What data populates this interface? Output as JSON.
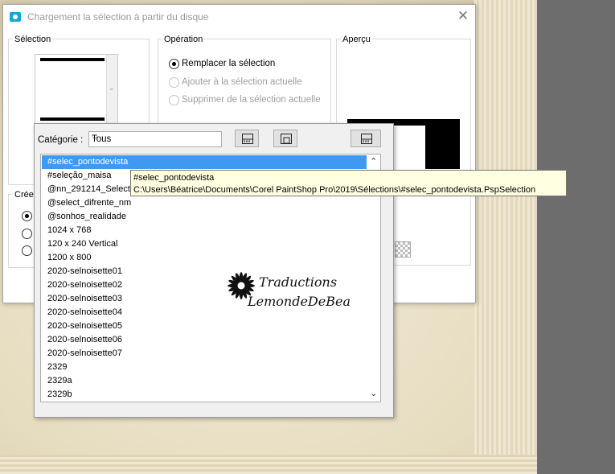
{
  "dialog": {
    "title": "Chargement la sélection à partir du disque",
    "groups": {
      "selection": "Sélection",
      "operation": "Opération",
      "preview": "Aperçu",
      "create": "Crée"
    },
    "operation_options": [
      {
        "label": "Remplacer la sélection",
        "selected": true,
        "enabled": true
      },
      {
        "label": "Ajouter à la sélection actuelle",
        "selected": false,
        "enabled": false
      },
      {
        "label": "Supprimer de la sélection actuelle",
        "selected": false,
        "enabled": false
      }
    ]
  },
  "panel": {
    "category_label": "Catégorie :",
    "category_value": "Tous",
    "items": [
      "#selec_pontodevista",
      "#seleção_maisa",
      "@nn_291214_Selectio",
      "@select_difrente_nm",
      "@sonhos_realidade",
      "1024 x 768",
      "120 x 240 Vertical",
      "1200 x 800",
      "2020-selnoisette01",
      "2020-selnoisette02",
      "2020-selnoisette03",
      "2020-selnoisette04",
      "2020-selnoisette05",
      "2020-selnoisette06",
      "2020-selnoisette07",
      "2329",
      "2329a",
      "2329b"
    ],
    "selected_index": 0
  },
  "tooltip": {
    "name": "#selec_pontodevista",
    "path": "C:\\Users\\Béatrice\\Documents\\Corel PaintShop Pro\\2019\\Sélections\\#selec_pontodevista.PspSelection"
  },
  "watermark": {
    "line1": "Traductions",
    "line2": "LemondeDeBea"
  },
  "colors": {
    "selection_highlight": "#3f99f0",
    "tooltip_bg": "#ffffe1",
    "title_icon": "#1aa3d9"
  }
}
